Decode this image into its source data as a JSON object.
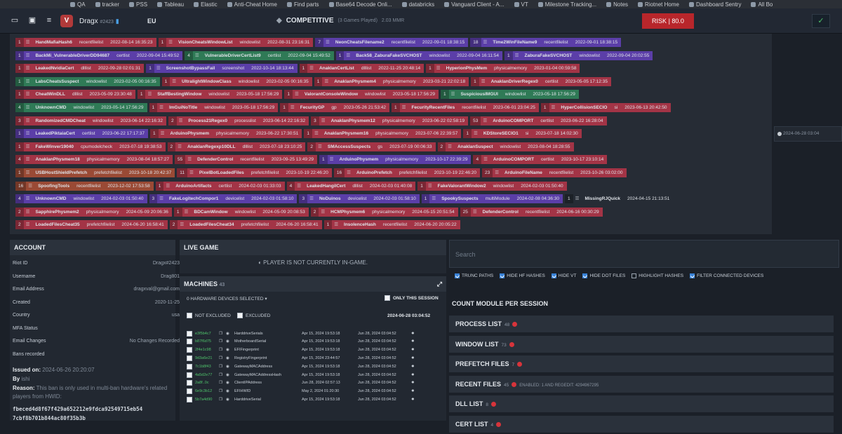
{
  "bookmarks": [
    "QA",
    "tracker",
    "PSS",
    "Tableau",
    "Elastic",
    "Anti-Cheat Home",
    "Find parts",
    "Base64 Decode Onli...",
    "databricks",
    "Vanguard Client - A...",
    "VT",
    "Milestone Tracking...",
    "Notes",
    "Riotnet Home",
    "Dashboard Sentry",
    "All Bo"
  ],
  "header": {
    "user": "Dragx",
    "tag": "#2423",
    "region": "EU",
    "mode": "COMPETITIVE",
    "games": "(3 Games Played)",
    "mmr": "2.03 MMR",
    "risk_label": "RISK",
    "risk_value": "80.0",
    "colors": {
      "risk": "#b8262b",
      "accent": "#4ec26a"
    }
  },
  "detections": [
    [
      [
        "1",
        "HandMafiaHash6",
        "recentfilelist",
        "2022-08-14 16:35:23",
        "r"
      ],
      [
        "1",
        "VisionCheatsWindowList",
        "windowlist",
        "2022-08-31 23:16:31",
        "r"
      ],
      [
        "7",
        "NeonCheatsFilename2",
        "recentfilelist",
        "2022-09-01 18:38:15",
        "p"
      ],
      [
        "18",
        "Time2WinFileName9",
        "recentfilelist",
        "2022-09-01 18:38:15",
        "p"
      ]
    ],
    [
      [
        "1",
        "BackMi_VulnerableDriverDD94687",
        "certlist",
        "2022-09-04 15:49:52",
        "p"
      ],
      [
        "4",
        "VulnerableDriverCertList9",
        "certlist",
        "2022-09-04 15:49:52",
        "g"
      ],
      [
        "1",
        "Back58_ZaburaFakeSVCHOST",
        "windowlist",
        "2022-09-04 16:11:54",
        "p"
      ],
      [
        "1",
        "ZaburaFakeSVCHOST",
        "windowlist",
        "2022-09-04 20:02:55",
        "p"
      ]
    ],
    [
      [
        "1",
        "LeakedNvidiaCert",
        "dlllist",
        "2022-09-28 02:01:31",
        "r"
      ],
      [
        "1",
        "ScreenshotBypassFail",
        "screenshot",
        "2022-10-14 18:13:44",
        "p"
      ],
      [
        "1",
        "AnaklanCertList",
        "dlllist",
        "2022-11-25 20:48:14",
        "r"
      ],
      [
        "1",
        "HyperionPhysMem",
        "physicalmemory",
        "2023-01-04 00:59:58",
        "r"
      ]
    ],
    [
      [
        "1",
        "LabsCheatsSuspect",
        "windowlist",
        "2023-02-05 00:16:35",
        "g"
      ],
      [
        "1",
        "UltralightWindowClass",
        "windowlist",
        "2023-02-05 00:16:35",
        "r"
      ],
      [
        "1",
        "AnaklanPhysmem4",
        "physicalmemory",
        "2023-03-21 22:02:18",
        "r"
      ],
      [
        "1",
        "AnaklanDriverRegex0",
        "certlist",
        "2023-05-05 17:12:35",
        "r"
      ]
    ],
    [
      [
        "1",
        "CheatWinDLL",
        "dlllist",
        "2023-05-09 23:30:48",
        "r"
      ],
      [
        "1",
        "StaffBestingWindow",
        "windowlist",
        "2023-05-18 17:56:29",
        "r"
      ],
      [
        "1",
        "ValorantConsoleWindow",
        "windowlist",
        "2023-05-18 17:56:29",
        "r"
      ],
      [
        "1",
        "SuspiciousIMGUI",
        "windowlist",
        "2023-05-18 17:56:29",
        "g"
      ]
    ],
    [
      [
        "4",
        "UnknownCMD",
        "windowlist",
        "2023-05-14 17:56:29",
        "g"
      ],
      [
        "1",
        "ImGuiNoTitle",
        "windowlist",
        "2023-05-18 17:56:29",
        "r"
      ],
      [
        "1",
        "FecurityGP",
        "gp",
        "2023-05-26 21:53:42",
        "r"
      ],
      [
        "1",
        "FecurityRecentFiles",
        "recentfilelist",
        "2023-06-01 23:04:25",
        "r"
      ],
      [
        "1",
        "HyperCollisionSECIO",
        "si",
        "2023-06-13 20:42:50",
        "r"
      ]
    ],
    [
      [
        "3",
        "RandomizedCMDCheat",
        "windowlist",
        "2023-06-14 22:16:32",
        "r"
      ],
      [
        "2",
        "Process21Regex0",
        "processlist",
        "2023-06-14 22:16:32",
        "r"
      ],
      [
        "3",
        "AnaklanPhysmem12",
        "physicalmemory",
        "2023-06-22 02:58:19",
        "r"
      ],
      [
        "53",
        "ArduinoCOMPORT",
        "certlist",
        "2023-06-22 16:28:04",
        "r"
      ]
    ],
    [
      [
        "1",
        "LeakedPiktaiaCert",
        "certlist",
        "2023-06-22 17:17:37",
        "p"
      ],
      [
        "1",
        "ArduinoPhysmem",
        "physicalmemory",
        "2023-06-22 17:30:51",
        "r"
      ],
      [
        "1",
        "AnaklanPhysmem16",
        "physicalmemory",
        "2023-07-06 22:39:57",
        "r"
      ],
      [
        "1",
        "KDStoreSECIO1",
        "si",
        "2023-07-18 14:02:30",
        "r"
      ]
    ],
    [
      [
        "1",
        "FakeWinver19040",
        "cpumodelcheck",
        "2023-07-18 19:38:53",
        "r"
      ],
      [
        "2",
        "AnaklanRegexp10DLL",
        "dlllist",
        "2023-07-18 23:10:25",
        "r"
      ],
      [
        "2",
        "SMAccessSuspects",
        "gs",
        "2023-07-19 00:06:33",
        "r"
      ],
      [
        "2",
        "AnaklanSuspect",
        "windowlist",
        "2023-08-04 18:28:55",
        "r"
      ]
    ],
    [
      [
        "4",
        "AnaklanPhysmem18",
        "physicalmemory",
        "2023-08-04 18:57:27",
        "r"
      ],
      [
        "55",
        "DefenderControl",
        "recentfilelist",
        "2023-09-25 13:49:29",
        "r"
      ],
      [
        "1",
        "ArduinoPhysmem",
        "physicalmemory",
        "2023-10-17 22:39:29",
        "p"
      ],
      [
        "4",
        "ArduinoCOMPORT",
        "certlist",
        "2023-10-17 23:10:14",
        "r"
      ]
    ],
    [
      [
        "1",
        "USBHostShieldPrefetch",
        "prefetchfilelist",
        "2023-10-18 20:42:37",
        "o"
      ],
      [
        "11",
        "PixelBotLoadedFiles",
        "prefetchfilelist",
        "2023-10-19 22:46:20",
        "r"
      ],
      [
        "16",
        "ArduinoPrefetch",
        "prefetchfilelist",
        "2023-10-19 22:46:20",
        "r"
      ],
      [
        "23",
        "ArduinoFileName",
        "recentfilelist",
        "2023-10-26 03:02:00",
        "r"
      ]
    ],
    [
      [
        "16",
        "SpoofingTools",
        "recentfilelist",
        "2023-12-02 17:53:58",
        "o"
      ],
      [
        "1",
        "ArduinoArtifacts",
        "certlist",
        "2024-02-03 01:33:03",
        "r"
      ],
      [
        "4",
        "LeakedHangilCert",
        "dlllist",
        "2024-02-03 01:40:08",
        "r"
      ],
      [
        "1",
        "FakeValorantWindow2",
        "windowlist",
        "2024-02-03 01:50:40",
        "r"
      ]
    ],
    [
      [
        "4",
        "UnknownCMD",
        "windowlist",
        "2024-02-03 01:50:40",
        "p"
      ],
      [
        "3",
        "FakeLogitechCompor1",
        "devicelist",
        "2024-02-03 01:58:10",
        "p"
      ],
      [
        "3",
        "NoDuinos",
        "devicelist",
        "2024-02-03 01:58:10",
        "p"
      ],
      [
        "1",
        "SpookySuspects",
        "multiModule",
        "2024-02-08 04:36:30",
        "p"
      ],
      [
        "1",
        "MissingRJQuick",
        "2024-04-15 21:13:51",
        "p"
      ]
    ],
    [
      [
        "2",
        "SapphirePhysmem2",
        "physicalmemory",
        "2024-05-09 20:06:36",
        "r"
      ],
      [
        "1",
        "BDCamWindow",
        "windowlist",
        "2024-05-09 20:08:53",
        "r"
      ],
      [
        "2",
        "HCMPhysmem6",
        "physicalmemory",
        "2024-05-15 20:51:54",
        "r"
      ],
      [
        "25",
        "DefenderControl",
        "recentfilelist",
        "2024-06-16 00:30:29",
        "r"
      ]
    ],
    [
      [
        "2",
        "LoadedFilesCheat35",
        "prefetchfilelist",
        "2024-06-20 16:58:41",
        "r"
      ],
      [
        "2",
        "LoadedFilesCheat34",
        "prefetchfilelist",
        "2024-06-20 16:58:41",
        "r"
      ],
      [
        "1",
        "InsolenceHash",
        "recentfilelist",
        "2024-06-20 20:05:22",
        "r"
      ]
    ]
  ],
  "side_note": "2024-06-28 03:04",
  "account": {
    "title": "ACCOUNT",
    "rows": [
      [
        "Riot ID",
        "Dragx#2423"
      ],
      [
        "Username",
        "Drag801"
      ],
      [
        "Email Address",
        "dragxval@gmail.com"
      ],
      [
        "Created",
        "2020-11-25"
      ],
      [
        "Country",
        "usa"
      ],
      [
        "MFA Status",
        ""
      ],
      [
        "Email Changes",
        "No Changes Recorded"
      ],
      [
        "Bans recorded",
        ""
      ]
    ],
    "issued_label": "Issued on:",
    "issued": "2024-06-26 20:20:07",
    "by_label": "By",
    "by": "ishi",
    "reason_label": "Reason:",
    "reason": "This ban is only used in multi-ban hardware's related players from HWID:",
    "hwid": "fbeced4d8f67f429a652212e9fdca92549715eb54",
    "hwid2": "7cbf8b701b844ac80f35b3b"
  },
  "live": {
    "title": "LIVE GAME",
    "status": "PLAYER IS NOT CURRENTLY IN-GAME."
  },
  "machines": {
    "title": "MACHINES",
    "count": "43",
    "selected": "0 HARDWARE DEVICES SELECTED",
    "only_session": "ONLY THIS SESSION",
    "not_excluded": "NOT EXCLUDED",
    "excluded": "EXCLUDED",
    "ts": "2024-06-28 03:04:52",
    "rows": [
      [
        "e3f5b4c7",
        "HarddriveSerials",
        "Apr 15, 2024 19:53:18",
        "Jun 28, 2024 03:04:52"
      ],
      [
        "b87f6d75",
        "MotherboardSerial",
        "Apr 15, 2024 19:53:18",
        "Jun 28, 2024 03:04:52"
      ],
      [
        "2f4e1c98",
        "EFIFingerprint",
        "Apr 15, 2024 19:53:18",
        "Jun 28, 2024 03:04:52"
      ],
      [
        "9d3a6e21",
        "RegistryFingerprint",
        "Apr 15, 2024 23:44:57",
        "Jun 28, 2024 03:04:52"
      ],
      [
        "7c1b8f43",
        "GatewayMACAddress",
        "Apr 15, 2024 19:53:18",
        "Jun 28, 2024 03:04:52"
      ],
      [
        "4a5d2e77",
        "GatewayMACAddressHash",
        "Apr 15, 2024 19:53:18",
        "Jun 28, 2024 03:04:52"
      ],
      [
        "2a8f..0c",
        "ClientIPAddress",
        "Jun 28, 2024 02:57:13",
        "Jun 28, 2024 03:04:52"
      ],
      [
        "6e9c3b12",
        "EFIHWID",
        "May 2, 2024 01:20:30",
        "Jun 28, 2024 03:04:52"
      ],
      [
        "5b7a4d90",
        "HarddriveSerial",
        "Apr 15, 2024 19:53:18",
        "Jun 28, 2024 03:04:52"
      ]
    ]
  },
  "search": {
    "placeholder": "Search"
  },
  "filters": [
    [
      "TRUNC PATHS",
      true
    ],
    [
      "HIDE HF HASHES",
      true
    ],
    [
      "HIDE VT",
      true
    ],
    [
      "HIDE DOT FILES",
      true
    ],
    [
      "HIGHLIGHT HASHES",
      false
    ],
    [
      "FILTER CONNECTED DEVICES",
      true
    ]
  ],
  "count_title": "COUNT MODULE PER SESSION",
  "modules": [
    [
      "PROCESS LIST",
      "48",
      ""
    ],
    [
      "WINDOW LIST",
      "73",
      ""
    ],
    [
      "PREFETCH FILES",
      "7",
      ""
    ],
    [
      "RECENT FILES",
      "45",
      "ENABLED: 1 AND REGEDIT: 4294967295"
    ],
    [
      "DLL LIST",
      "8",
      ""
    ],
    [
      "CERT LIST",
      "4",
      ""
    ]
  ]
}
